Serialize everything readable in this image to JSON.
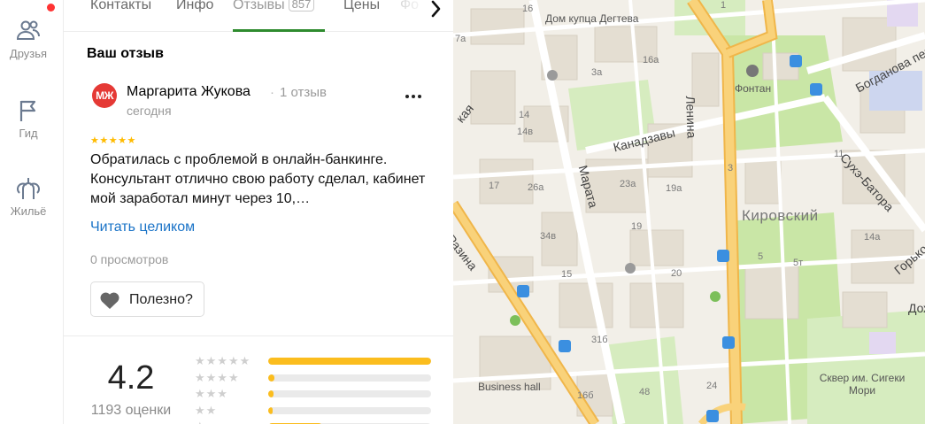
{
  "rail": {
    "items": [
      {
        "label": "Друзья",
        "icon": "friends-icon",
        "has_notification": true
      },
      {
        "label": "Гид",
        "icon": "flag-icon"
      },
      {
        "label": "Жильё",
        "icon": "housing-icon"
      }
    ]
  },
  "tabs": {
    "items": [
      {
        "label": "Контакты"
      },
      {
        "label": "Инфо"
      },
      {
        "label": "Отзывы",
        "count": "857",
        "active": true
      },
      {
        "label": "Цены"
      },
      {
        "label": "Фо"
      }
    ]
  },
  "review": {
    "section_title": "Ваш отзыв",
    "author": {
      "name": "Маргарита Жукова",
      "initials": "МЖ",
      "review_count": "1 отзыв",
      "avatar_color": "#e53935"
    },
    "date": "сегодня",
    "stars": 5,
    "stars_text": "★★★★★",
    "text": "Обратилась с проблемой в онлайн-банкинге. Консультант отлично свою работу сделал, кабинет мой заработал минут через 10,…",
    "read_more": "Читать целиком",
    "views": "0 просмотров",
    "useful_label": "Полезно?"
  },
  "rating": {
    "value": "4.2",
    "count_text": "1193 оценки",
    "distribution": [
      {
        "stars": 5,
        "stars_text": "★★★★★",
        "fraction": 1.0
      },
      {
        "stars": 4,
        "stars_text": "★★★★",
        "fraction": 0.04
      },
      {
        "stars": 3,
        "stars_text": "★★★",
        "fraction": 0.03
      },
      {
        "stars": 2,
        "stars_text": "★★",
        "fraction": 0.02
      },
      {
        "stars": 1,
        "stars_text": "★",
        "fraction": 0.33
      }
    ]
  },
  "map": {
    "labels": {
      "house": "Дом купца Дегтева",
      "fountain": "Фонтан",
      "district": "Кировский",
      "business_hall": "Business hall",
      "square": "Сквер им. Сигеки Мори",
      "lenina": "Ленина",
      "kanadzavy": "Канадзавы",
      "marata": "Марата",
      "razina": "Разина",
      "sukhe": "Сухэ-Батора",
      "bogdanova": "Богданова пер",
      "gorky": "Горько",
      "dozh": "Дож",
      "kaya": "кая"
    },
    "numbers": [
      "16",
      "7а",
      "3а",
      "16а",
      "14",
      "14в",
      "26а",
      "17",
      "23а",
      "19а",
      "34в",
      "15",
      "19",
      "20",
      "31б",
      "16б",
      "48",
      "24",
      "3",
      "5",
      "5т",
      "14а",
      "11",
      "1"
    ],
    "colors": {
      "road_main": "#f9d27a",
      "park": "#c9e6a6",
      "building": "#e4ded2",
      "transport": "#3b8fe0"
    }
  }
}
